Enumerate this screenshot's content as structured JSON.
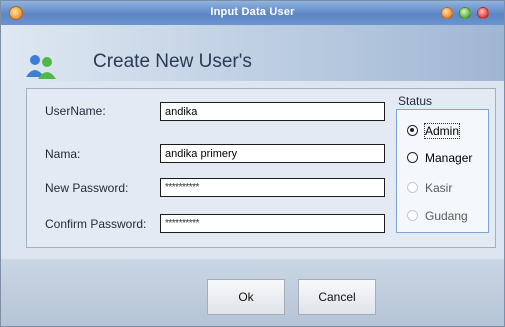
{
  "window": {
    "title": "Input Data User"
  },
  "header": {
    "title": "Create New User's"
  },
  "form": {
    "username": {
      "label": "UserName:",
      "value": "andika"
    },
    "nama": {
      "label": "Nama:",
      "value": "andika primery"
    },
    "new_password": {
      "label": "New Password:",
      "value": "**********"
    },
    "confirm_password": {
      "label": "Confirm Password:",
      "value": "**********"
    }
  },
  "status": {
    "label": "Status",
    "options": [
      {
        "label": "Admin",
        "checked": true,
        "enabled": true
      },
      {
        "label": "Manager",
        "checked": false,
        "enabled": true
      },
      {
        "label": "Kasir",
        "checked": false,
        "enabled": false
      },
      {
        "label": "Gudang",
        "checked": false,
        "enabled": false
      }
    ]
  },
  "buttons": {
    "ok": "Ok",
    "cancel": "Cancel"
  },
  "colors": {
    "titlebar": "#5d86c4",
    "header_text": "#2b3a55"
  }
}
